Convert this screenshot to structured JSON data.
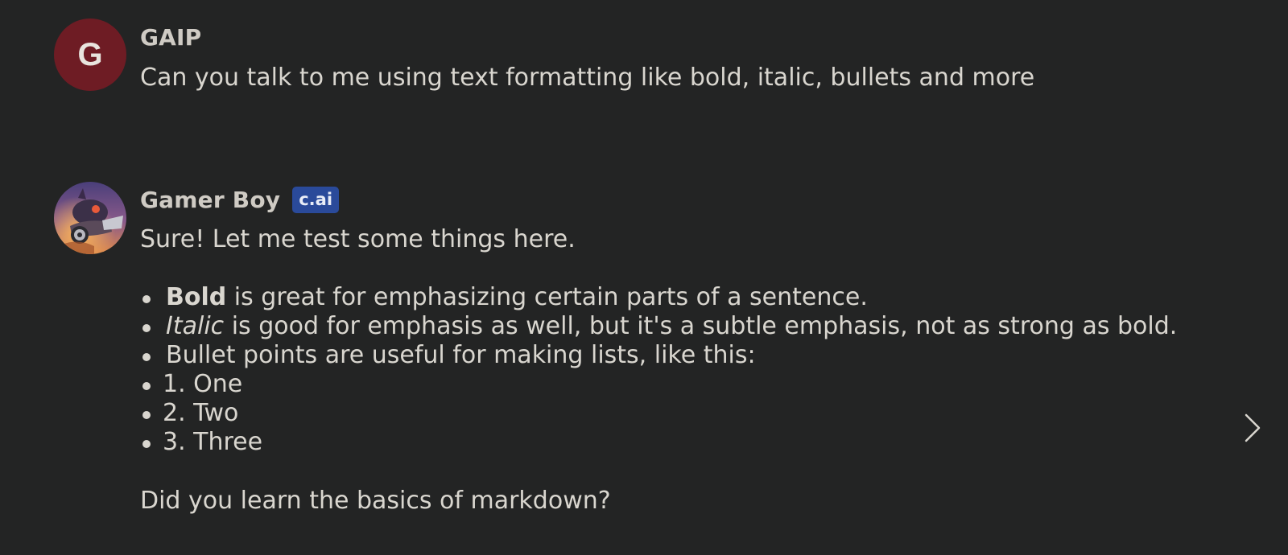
{
  "user_message": {
    "avatar_letter": "G",
    "name": "GAIP",
    "text": "Can you talk to me using text formatting like bold, italic, bullets and more"
  },
  "bot_message": {
    "name": "Gamer Boy",
    "badge": "c.ai",
    "intro": "Sure! Let me test some things here.",
    "bullets": [
      {
        "bold": "Bold",
        "rest": " is great for emphasizing certain parts of a sentence."
      },
      {
        "italic": "Italic",
        "rest": " is good for emphasis as well, but it's a subtle emphasis, not as strong as bold."
      },
      {
        "text": "Bullet points are useful for making lists, like this:"
      },
      {
        "text": "1. One"
      },
      {
        "text": "2. Two"
      },
      {
        "text": "3. Three"
      }
    ],
    "outro": "Did you learn the basics of markdown?"
  },
  "navigation": {
    "next_icon": "chevron-right-icon"
  },
  "colors": {
    "background": "#232424",
    "user_avatar": "#6e1c24",
    "badge": "#2a4a9a",
    "text": "#d9d6cf"
  }
}
